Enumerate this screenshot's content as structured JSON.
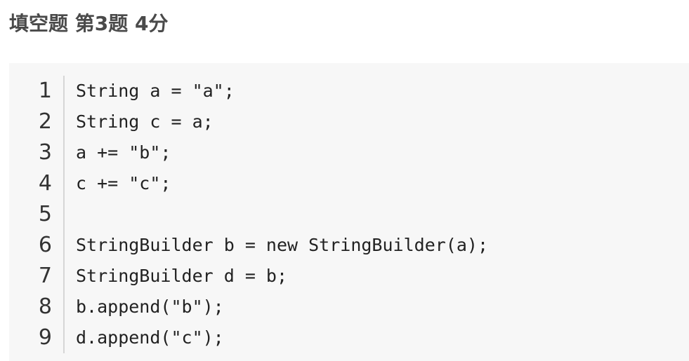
{
  "question": {
    "title": "填空题 第3题 4分"
  },
  "code": {
    "lines": [
      {
        "number": "1",
        "text": "String a = \"a\";"
      },
      {
        "number": "2",
        "text": "String c = a;"
      },
      {
        "number": "3",
        "text": "a += \"b\";"
      },
      {
        "number": "4",
        "text": "c += \"c\";"
      },
      {
        "number": "5",
        "text": ""
      },
      {
        "number": "6",
        "text": "StringBuilder b = new StringBuilder(a);"
      },
      {
        "number": "7",
        "text": "StringBuilder d = b;"
      },
      {
        "number": "8",
        "text": "b.append(\"b\");"
      },
      {
        "number": "9",
        "text": "d.append(\"c\");"
      }
    ]
  }
}
